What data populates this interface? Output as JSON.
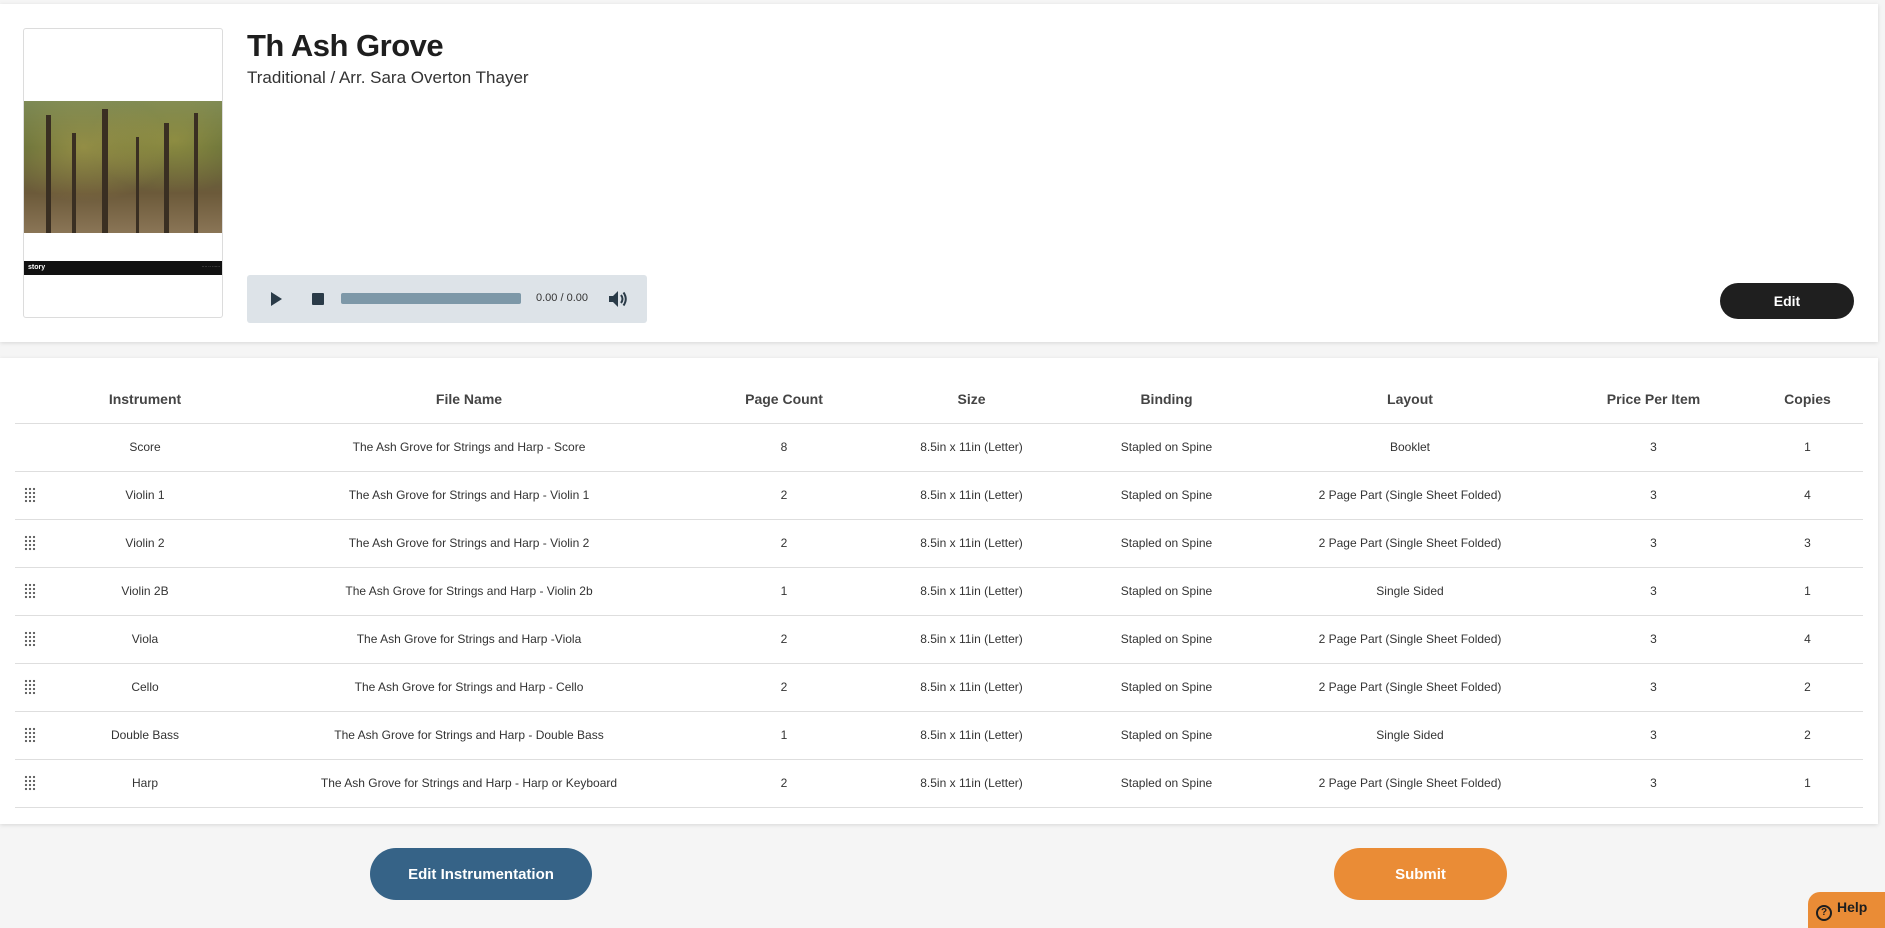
{
  "piece": {
    "title": "Th Ash Grove",
    "subtitle": "Traditional / Arr. Sara Overton Thayer",
    "cover_band_text": "story"
  },
  "player": {
    "time": "0.00 / 0.00",
    "progress": 0
  },
  "buttons": {
    "edit": "Edit",
    "edit_instrumentation": "Edit Instrumentation",
    "submit": "Submit",
    "help": "Help"
  },
  "table": {
    "headers": [
      "Instrument",
      "File Name",
      "Page Count",
      "Size",
      "Binding",
      "Layout",
      "Price Per Item",
      "Copies"
    ],
    "rows": [
      {
        "draggable": false,
        "instrument": "Score",
        "file": "The Ash Grove for Strings and Harp - Score",
        "pages": "8",
        "size": "8.5in x 11in (Letter)",
        "binding": "Stapled on Spine",
        "layout": "Booklet",
        "price": "3",
        "copies": "1"
      },
      {
        "draggable": true,
        "instrument": "Violin 1",
        "file": "The Ash Grove for Strings and Harp - Violin 1",
        "pages": "2",
        "size": "8.5in x 11in (Letter)",
        "binding": "Stapled on Spine",
        "layout": "2 Page Part (Single Sheet Folded)",
        "price": "3",
        "copies": "4"
      },
      {
        "draggable": true,
        "instrument": "Violin 2",
        "file": "The Ash Grove for Strings and Harp - Violin 2",
        "pages": "2",
        "size": "8.5in x 11in (Letter)",
        "binding": "Stapled on Spine",
        "layout": "2 Page Part (Single Sheet Folded)",
        "price": "3",
        "copies": "3"
      },
      {
        "draggable": true,
        "instrument": "Violin 2B",
        "file": "The Ash Grove for Strings and Harp - Violin 2b",
        "pages": "1",
        "size": "8.5in x 11in (Letter)",
        "binding": "Stapled on Spine",
        "layout": "Single Sided",
        "price": "3",
        "copies": "1"
      },
      {
        "draggable": true,
        "instrument": "Viola",
        "file": "The Ash Grove for Strings and Harp -Viola",
        "pages": "2",
        "size": "8.5in x 11in (Letter)",
        "binding": "Stapled on Spine",
        "layout": "2 Page Part (Single Sheet Folded)",
        "price": "3",
        "copies": "4"
      },
      {
        "draggable": true,
        "instrument": "Cello",
        "file": "The Ash Grove for Strings and Harp - Cello",
        "pages": "2",
        "size": "8.5in x 11in (Letter)",
        "binding": "Stapled on Spine",
        "layout": "2 Page Part (Single Sheet Folded)",
        "price": "3",
        "copies": "2"
      },
      {
        "draggable": true,
        "instrument": "Double Bass",
        "file": "The Ash Grove for Strings and Harp - Double Bass",
        "pages": "1",
        "size": "8.5in x 11in (Letter)",
        "binding": "Stapled on Spine",
        "layout": "Single Sided",
        "price": "3",
        "copies": "2"
      },
      {
        "draggable": true,
        "instrument": "Harp",
        "file": "The Ash Grove for Strings and Harp - Harp or Keyboard",
        "pages": "2",
        "size": "8.5in x 11in (Letter)",
        "binding": "Stapled on Spine",
        "layout": "2 Page Part (Single Sheet Folded)",
        "price": "3",
        "copies": "1"
      }
    ]
  }
}
